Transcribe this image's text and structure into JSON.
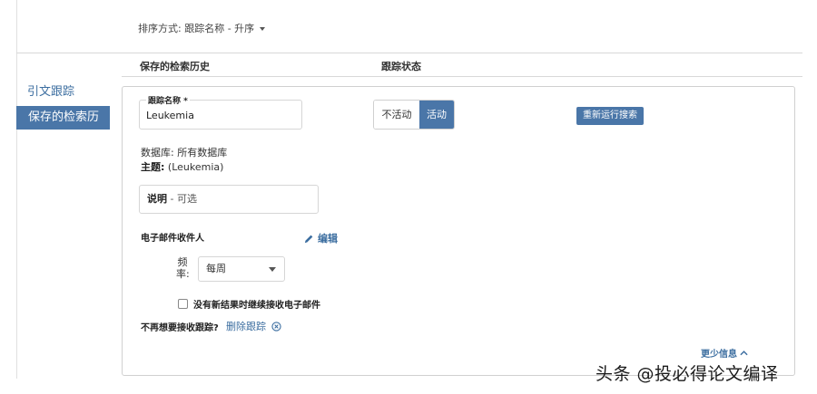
{
  "sort": {
    "label": "排序方式: 跟踪名称 - 升序"
  },
  "columns": {
    "saved_history": "保存的检索历史",
    "tracking_status": "跟踪状态"
  },
  "sidebar": {
    "items": [
      {
        "label": "引文跟踪"
      },
      {
        "label": "保存的检索历史"
      }
    ]
  },
  "tracker": {
    "name_label": "跟踪名称 *",
    "name_value": "Leukemia",
    "status_inactive": "不活动",
    "status_active": "活动",
    "rerun_label": "重新运行搜索",
    "database_line": "数据库: 所有数据库",
    "topic_label": "主题:",
    "topic_value": "(Leukemia)",
    "desc_label": "说明",
    "desc_optional": "- 可选",
    "email_label": "电子邮件收件人",
    "edit_label": "编辑",
    "frequency_label": "频率:",
    "frequency_value": "每周",
    "no_results_label": "没有新结果时继续接收电子邮件",
    "stop_prompt": "不再想要接收跟踪?",
    "delete_label": "删除跟踪",
    "less_info_label": "更少信息"
  },
  "watermark": "头条 @投必得论文编译",
  "colors": {
    "accent": "#4a76a8",
    "link": "#3c6ea0"
  }
}
